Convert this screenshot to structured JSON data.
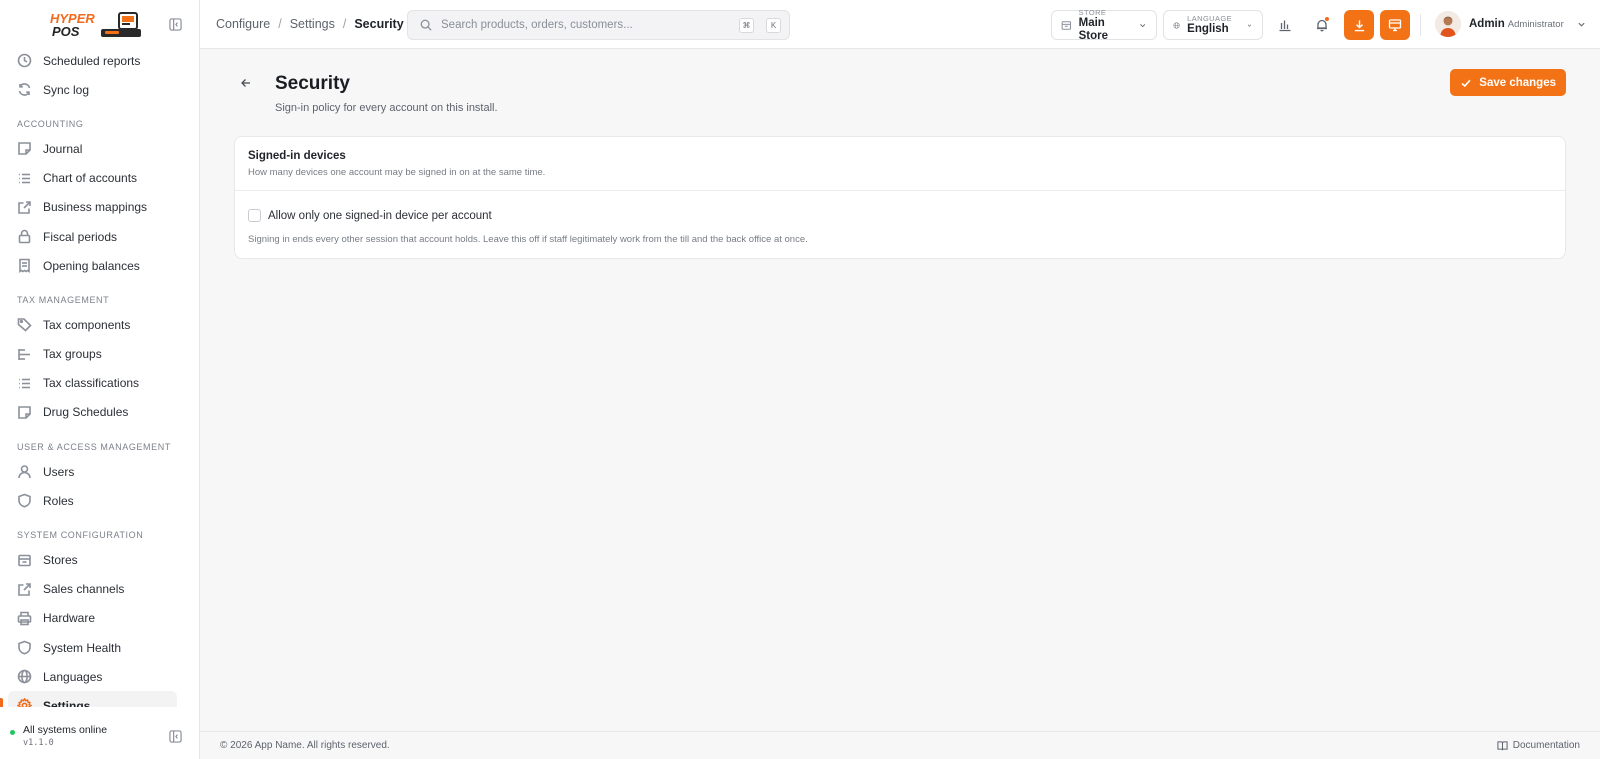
{
  "app": {
    "logo_line1": "HYPER",
    "logo_line2": "POS",
    "brand_color": "#f47216"
  },
  "sidebar": {
    "items_top": [
      {
        "label": "Scheduled reports",
        "icon": "clock-icon"
      },
      {
        "label": "Sync log",
        "icon": "refresh-icon"
      }
    ],
    "sections": [
      {
        "title": "ACCOUNTING",
        "items": [
          {
            "label": "Journal",
            "icon": "note-icon"
          },
          {
            "label": "Chart of accounts",
            "icon": "list-icon"
          },
          {
            "label": "Business mappings",
            "icon": "external-link-icon"
          },
          {
            "label": "Fiscal periods",
            "icon": "lock-icon"
          },
          {
            "label": "Opening balances",
            "icon": "receipt-icon"
          }
        ]
      },
      {
        "title": "TAX MANAGEMENT",
        "items": [
          {
            "label": "Tax components",
            "icon": "tag-icon"
          },
          {
            "label": "Tax groups",
            "icon": "hierarchy-icon"
          },
          {
            "label": "Tax classifications",
            "icon": "list-icon"
          },
          {
            "label": "Drug Schedules",
            "icon": "note-icon"
          }
        ]
      },
      {
        "title": "USER & ACCESS MANAGEMENT",
        "items": [
          {
            "label": "Users",
            "icon": "user-icon"
          },
          {
            "label": "Roles",
            "icon": "shield-icon"
          }
        ]
      },
      {
        "title": "SYSTEM CONFIGURATION",
        "items": [
          {
            "label": "Stores",
            "icon": "store-icon"
          },
          {
            "label": "Sales channels",
            "icon": "external-link-icon"
          },
          {
            "label": "Hardware",
            "icon": "printer-icon"
          },
          {
            "label": "System Health",
            "icon": "shield-icon"
          },
          {
            "label": "Languages",
            "icon": "globe-icon"
          },
          {
            "label": "Settings",
            "icon": "gear-icon",
            "active": true
          }
        ]
      }
    ],
    "status_label": "All systems online",
    "version": "v1.1.0"
  },
  "topbar": {
    "breadcrumb": [
      "Configure",
      "Settings",
      "Security"
    ],
    "search_placeholder": "Search products, orders, customers...",
    "kbd_1": "⌘",
    "kbd_2": "K",
    "store_caption": "STORE",
    "store_value": "Main Store",
    "language_caption": "LANGUAGE",
    "language_value": "English",
    "user_name": "Admin",
    "user_role": "Administrator"
  },
  "page": {
    "title": "Security",
    "subtitle": "Sign-in policy for every account on this install.",
    "save_label": "Save changes"
  },
  "card": {
    "title": "Signed-in devices",
    "description": "How many devices one account may be signed in on at the same time.",
    "checkbox_label": "Allow only one signed-in device per account",
    "checkbox_checked": false,
    "note": "Signing in ends every other session that account holds. Leave this off if staff legitimately work from the till and the back office at once."
  },
  "footer": {
    "copyright": "© 2026 App Name. All rights reserved.",
    "doc_label": "Documentation"
  }
}
